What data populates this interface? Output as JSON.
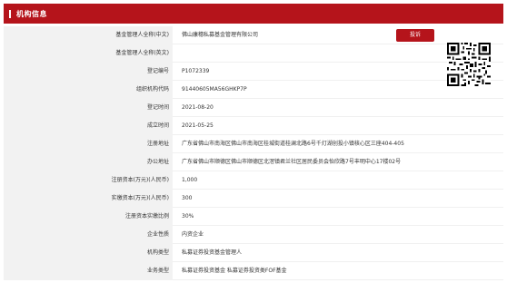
{
  "header": {
    "title": "机构信息"
  },
  "complain_button": "投诉",
  "qr_code": "qr-code",
  "rows": [
    {
      "label": "基金管理人全称(中文)",
      "value": "佛山康穗私募基金管理有限公司"
    },
    {
      "label": "基金管理人全称(英文)",
      "value": ""
    },
    {
      "label": "登记编号",
      "value": "P1072339"
    },
    {
      "label": "组织机构代码",
      "value": "91440605MA56GHKP7P"
    },
    {
      "label": "登记时间",
      "value": "2021-08-20"
    },
    {
      "label": "成立时间",
      "value": "2021-05-25"
    },
    {
      "label": "注册地址",
      "value": "广东省佛山市南海区佛山市南海区桂城街道桂澜北路6号千灯湖创投小镇核心区三座404-405"
    },
    {
      "label": "办公地址",
      "value": "广东省佛山市顺德区佛山市顺德区北滘镇君兰社区居民委员会怡欣路7号丰明中心17楼02号"
    },
    {
      "label": "注册资本(万元)(人民币)",
      "value": "1,000"
    },
    {
      "label": "实缴资本(万元)(人民币)",
      "value": "300"
    },
    {
      "label": "注册资本实缴比例",
      "value": "30%"
    },
    {
      "label": "企业性质",
      "value": "内资企业"
    },
    {
      "label": "机构类型",
      "value": "私募证券投资基金管理人"
    },
    {
      "label": "业务类型",
      "value": "私募证券投资基金  私募证券投资类FOF基金"
    }
  ]
}
